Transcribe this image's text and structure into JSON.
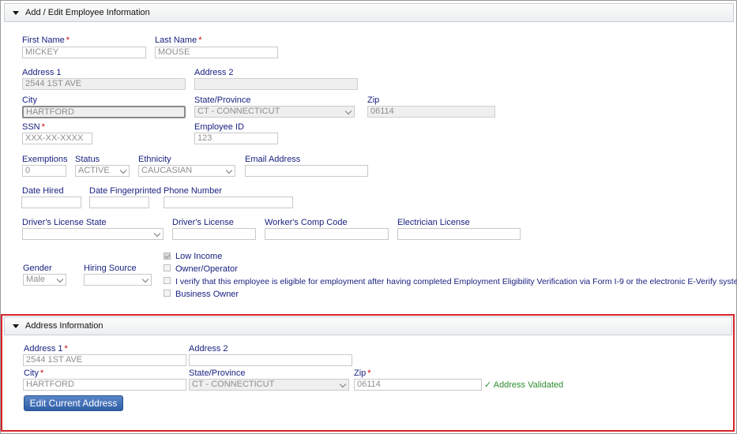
{
  "employee_panel": {
    "title": "Add / Edit Employee Information",
    "first_name": {
      "label": "First Name",
      "value": "MICKEY"
    },
    "last_name": {
      "label": "Last Name",
      "value": "MOUSE"
    },
    "address1": {
      "label": "Address 1",
      "value": "2544 1ST AVE"
    },
    "address2": {
      "label": "Address 2",
      "value": ""
    },
    "city": {
      "label": "City",
      "value": "HARTFORD"
    },
    "state": {
      "label": "State/Province",
      "value": "CT - CONNECTICUT"
    },
    "zip": {
      "label": "Zip",
      "value": "06114"
    },
    "ssn": {
      "label": "SSN",
      "placeholder": "XXX-XX-XXXX"
    },
    "employee_id": {
      "label": "Employee ID",
      "value": "123"
    },
    "exemptions": {
      "label": "Exemptions",
      "value": "0"
    },
    "status": {
      "label": "Status",
      "value": "ACTIVE"
    },
    "ethnicity": {
      "label": "Ethnicity",
      "value": "CAUCASIAN"
    },
    "email": {
      "label": "Email Address",
      "value": ""
    },
    "date_hired": {
      "label": "Date Hired",
      "value": ""
    },
    "date_fingerprinted": {
      "label": "Date Fingerprinted",
      "value": ""
    },
    "phone": {
      "label": "Phone Number",
      "value": ""
    },
    "dl_state": {
      "label": "Driver's License State",
      "value": ""
    },
    "dl": {
      "label": "Driver's License",
      "value": ""
    },
    "workers_comp": {
      "label": "Worker's Comp Code",
      "value": ""
    },
    "electrician": {
      "label": "Electrician License",
      "value": ""
    },
    "gender": {
      "label": "Gender",
      "value": "Male"
    },
    "hiring_source": {
      "label": "Hiring Source",
      "value": ""
    },
    "checkboxes": [
      {
        "label": "Low Income",
        "checked": true
      },
      {
        "label": "Owner/Operator",
        "checked": false
      },
      {
        "label": "I verify that this employee is eligible for employment after having completed Employment Eligibility Verification via Form I-9 or the electronic E-Verify system.",
        "checked": false
      },
      {
        "label": "Business Owner",
        "checked": false
      }
    ]
  },
  "address_panel": {
    "title": "Address Information",
    "address1": {
      "label": "Address 1",
      "value": "2544 1ST AVE"
    },
    "address2": {
      "label": "Address 2",
      "value": ""
    },
    "city": {
      "label": "City",
      "value": "HARTFORD"
    },
    "state": {
      "label": "State/Province",
      "value": "CT - CONNECTICUT"
    },
    "zip": {
      "label": "Zip",
      "value": "06114"
    },
    "validated": "Address Validated",
    "edit_button": "Edit Current Address"
  },
  "required_mark": "*",
  "colors": {
    "label": "#1a2280",
    "required": "#d10000",
    "highlight_border": "#d8232a",
    "button": "#2e5ea8",
    "success": "#2e8b2e"
  }
}
